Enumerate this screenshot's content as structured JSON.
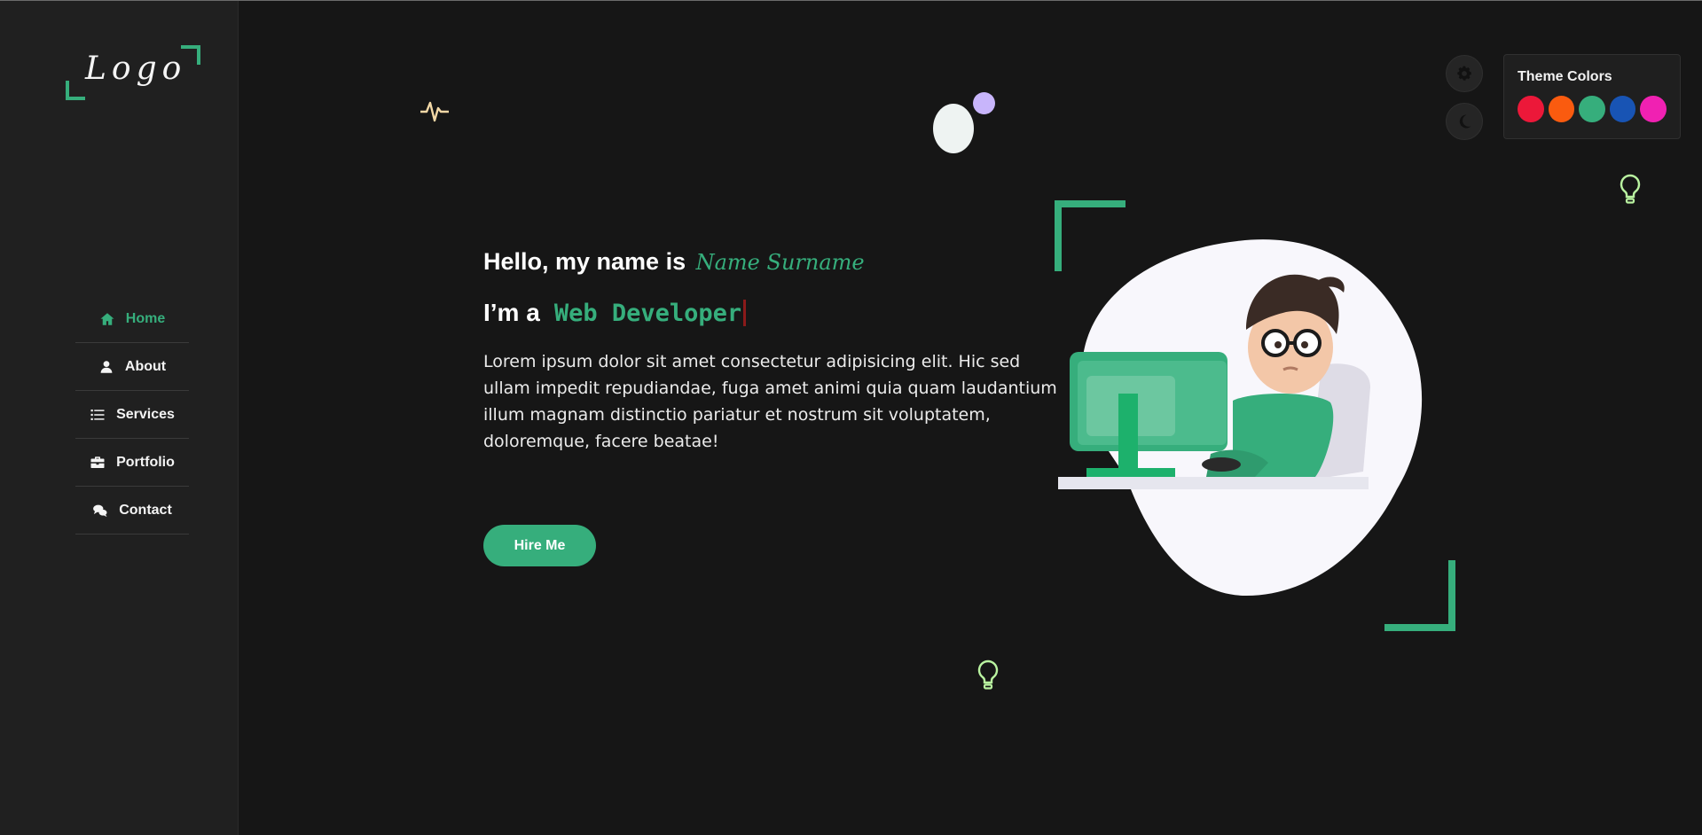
{
  "sidebar": {
    "logo": "Logo",
    "nav": [
      {
        "label": "Home",
        "icon": "home-icon",
        "active": true
      },
      {
        "label": "About",
        "icon": "user-icon",
        "active": false
      },
      {
        "label": "Services",
        "icon": "list-icon",
        "active": false
      },
      {
        "label": "Portfolio",
        "icon": "briefcase-icon",
        "active": false
      },
      {
        "label": "Contact",
        "icon": "comments-icon",
        "active": false
      }
    ]
  },
  "hero": {
    "greeting": "Hello, my name is",
    "name": "Name Surname",
    "role_prefix": "I’m a",
    "role_typed": "Web Developer",
    "description": "Lorem ipsum dolor sit amet consectetur adipisicing elit. Hic sed ullam impedit repudiandae, fuga amet animi quia quam laudantium illum magnam distinctio pariatur et nostrum sit voluptatem, doloremque, facere beatae!",
    "cta": "Hire Me"
  },
  "settings": {
    "theme_title": "Theme Colors",
    "theme_colors": [
      "#ec1839",
      "#fa5b0f",
      "#36ae7c",
      "#1854b4",
      "#f021b2"
    ]
  },
  "colors": {
    "accent": "#36ae7c",
    "background": "#161616",
    "sidebar": "#202020"
  }
}
